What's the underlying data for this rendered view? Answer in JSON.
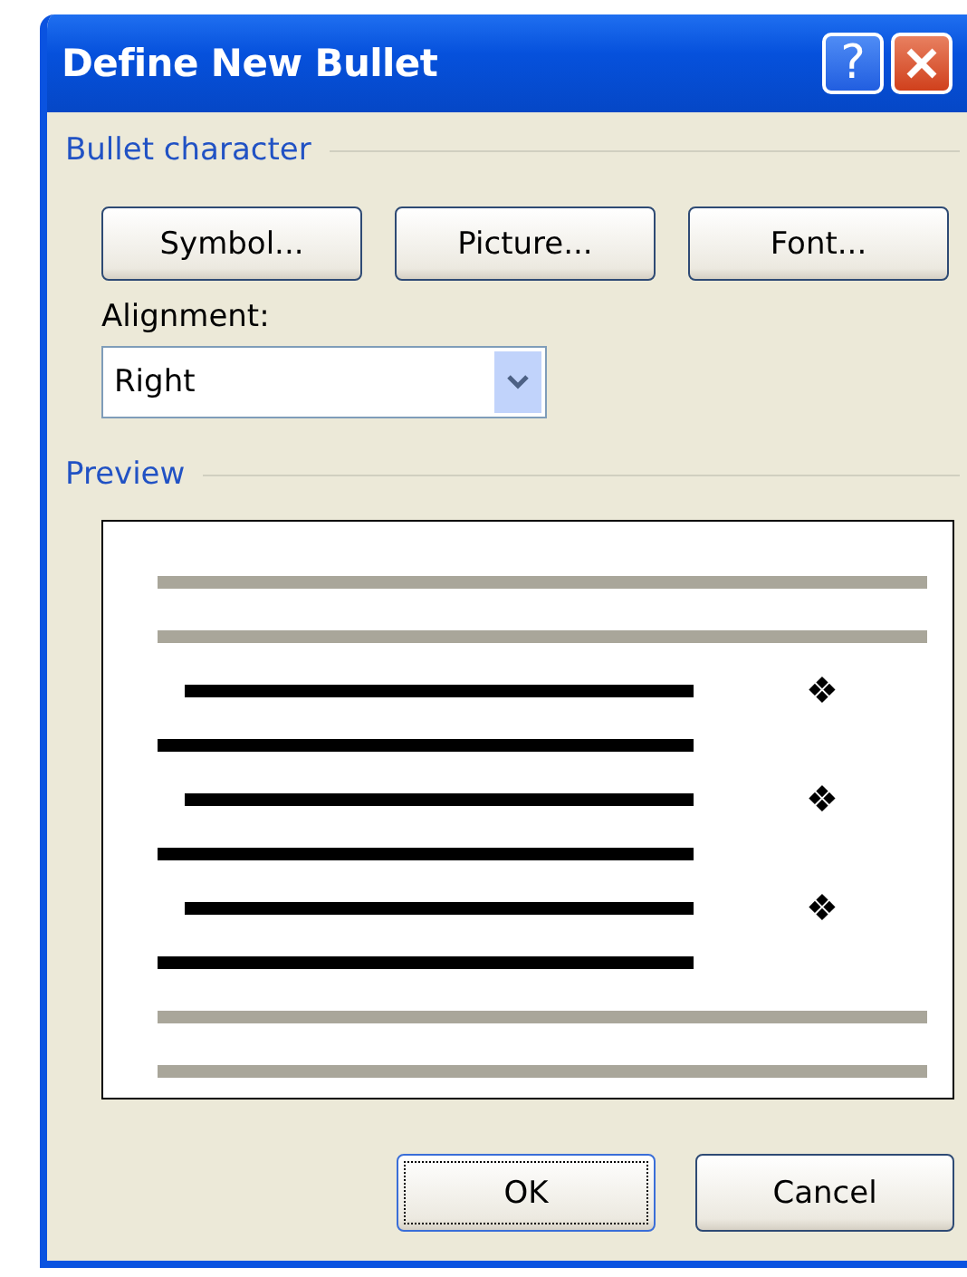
{
  "window": {
    "title": "Define New Bullet",
    "help_button": "?"
  },
  "bullet_character": {
    "heading": "Bullet character",
    "buttons": [
      "Symbol...",
      "Picture...",
      "Font..."
    ]
  },
  "alignment": {
    "label": "Alignment:",
    "value": "Right"
  },
  "preview": {
    "heading": "Preview",
    "lines": [
      {
        "kind": "context"
      },
      {
        "kind": "context"
      },
      {
        "kind": "bulleted",
        "bullet": "❖"
      },
      {
        "kind": "continuation"
      },
      {
        "kind": "bulleted",
        "bullet": "❖"
      },
      {
        "kind": "continuation"
      },
      {
        "kind": "bulleted",
        "bullet": "❖"
      },
      {
        "kind": "continuation"
      },
      {
        "kind": "context"
      },
      {
        "kind": "context"
      }
    ]
  },
  "buttons": [
    {
      "label": "OK",
      "focused": true
    },
    {
      "label": "Cancel",
      "focused": false
    }
  ]
}
